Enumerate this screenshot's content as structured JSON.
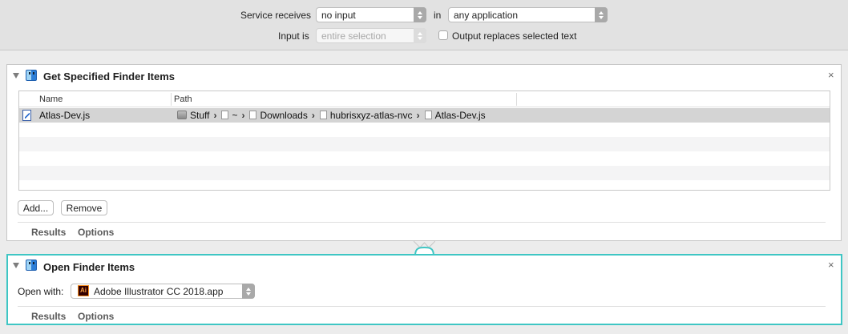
{
  "service": {
    "receives_label": "Service receives",
    "receives_value": "no input",
    "in_label": "in",
    "application_value": "any application",
    "input_is_label": "Input is",
    "input_is_value": "entire selection",
    "output_replaces_label": "Output replaces selected text",
    "output_replaces_checked": false
  },
  "actions": [
    {
      "title": "Get Specified Finder Items",
      "table": {
        "columns": [
          "Name",
          "Path"
        ],
        "rows": [
          {
            "name": "Atlas-Dev.js",
            "path": [
              "Stuff",
              "~",
              "Downloads",
              "hubrisxyz-atlas-nvc",
              "Atlas-Dev.js"
            ]
          }
        ]
      },
      "add_label": "Add...",
      "remove_label": "Remove",
      "tabs": [
        "Results",
        "Options"
      ]
    },
    {
      "title": "Open Finder Items",
      "open_with_label": "Open with:",
      "open_with_value": "Adobe Illustrator CC 2018.app",
      "app_badge": "Ai",
      "tabs": [
        "Results",
        "Options"
      ],
      "accent": "#3fc6c4"
    }
  ]
}
